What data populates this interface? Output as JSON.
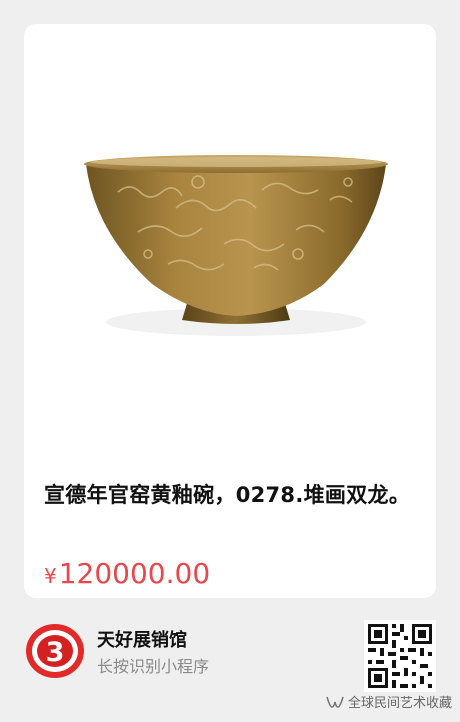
{
  "product": {
    "title": "宣德年官窑黄釉碗，0278.堆画双龙。",
    "currency": "¥",
    "price": "120000.00",
    "image_subject": "yellow-glazed porcelain bowl"
  },
  "mini_program": {
    "shop_name": "天好展销馆",
    "subtitle": "长按识别小程序",
    "logo_glyph": "3",
    "logo_color": "#e32a2a"
  },
  "watermark": {
    "text": "全球民间艺术收藏",
    "icon": "wechat-channel-icon"
  },
  "colors": {
    "price": "#e8474d",
    "background": "#efefef",
    "card": "#ffffff"
  }
}
